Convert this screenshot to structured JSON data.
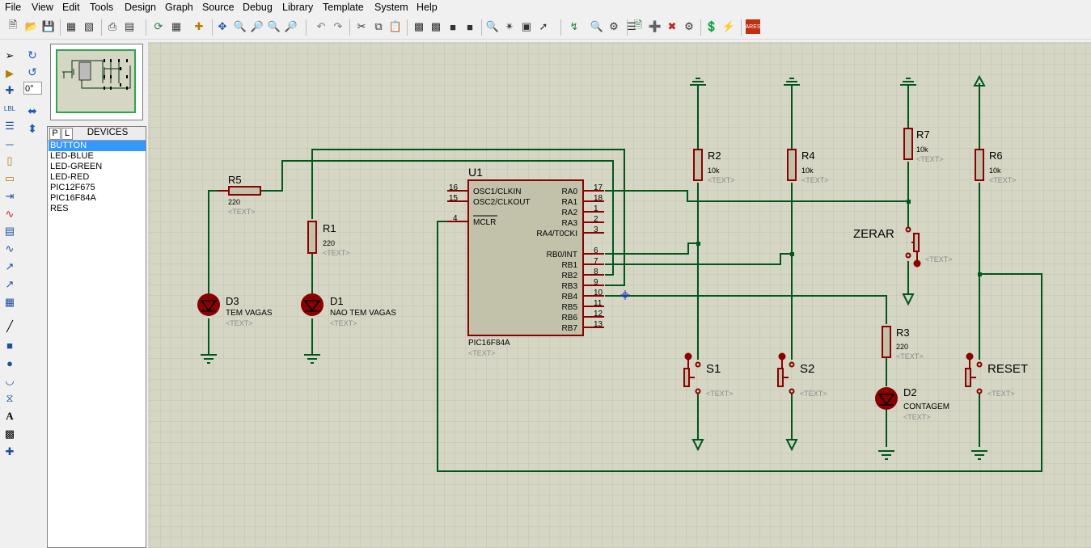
{
  "menu": [
    "File",
    "View",
    "Edit",
    "Tools",
    "Design",
    "Graph",
    "Source",
    "Debug",
    "Library",
    "Template",
    "System",
    "Help"
  ],
  "rotation": "0°",
  "device_panel": {
    "p_label": "P",
    "l_label": "L",
    "title": "DEVICES",
    "items": [
      "BUTTON",
      "LED-BLUE",
      "LED-GREEN",
      "LED-RED",
      "PIC12F675",
      "PIC16F84A",
      "RES"
    ],
    "selected": "BUTTON"
  },
  "schematic": {
    "chip": {
      "ref": "U1",
      "part": "PIC16F84A",
      "text": "<TEXT>",
      "left_pins": [
        {
          "num": "16",
          "name": "OSC1/CLKIN"
        },
        {
          "num": "15",
          "name": "OSC2/CLKOUT"
        },
        {
          "num": "4",
          "name": "MCLR"
        }
      ],
      "right_pins": [
        {
          "num": "17",
          "name": "RA0"
        },
        {
          "num": "18",
          "name": "RA1"
        },
        {
          "num": "1",
          "name": "RA2"
        },
        {
          "num": "2",
          "name": "RA3"
        },
        {
          "num": "3",
          "name": "RA4/T0CKI"
        },
        {
          "num": "6",
          "name": "RB0/INT"
        },
        {
          "num": "7",
          "name": "RB1"
        },
        {
          "num": "8",
          "name": "RB2"
        },
        {
          "num": "9",
          "name": "RB3"
        },
        {
          "num": "10",
          "name": "RB4"
        },
        {
          "num": "11",
          "name": "RB5"
        },
        {
          "num": "12",
          "name": "RB6"
        },
        {
          "num": "13",
          "name": "RB7"
        }
      ]
    },
    "resistors": [
      {
        "ref": "R5",
        "value": "220",
        "text": "<TEXT>"
      },
      {
        "ref": "R1",
        "value": "220",
        "text": "<TEXT>"
      },
      {
        "ref": "R2",
        "value": "10k",
        "text": "<TEXT>"
      },
      {
        "ref": "R4",
        "value": "10k",
        "text": "<TEXT>"
      },
      {
        "ref": "R7",
        "value": "10k",
        "text": "<TEXT>"
      },
      {
        "ref": "R6",
        "value": "10k",
        "text": "<TEXT>"
      },
      {
        "ref": "R3",
        "value": "220",
        "text": "<TEXT>"
      }
    ],
    "leds": [
      {
        "ref": "D3",
        "label": "TEM VAGAS",
        "text": "<TEXT>"
      },
      {
        "ref": "D1",
        "label": "NAO TEM VAGAS",
        "text": "<TEXT>"
      },
      {
        "ref": "D2",
        "label": "CONTAGEM",
        "text": "<TEXT>"
      }
    ],
    "buttons": [
      {
        "ref": "S1",
        "text": "<TEXT>"
      },
      {
        "ref": "S2",
        "text": "<TEXT>"
      },
      {
        "ref": "RESET",
        "text": "<TEXT>"
      },
      {
        "ref": "ZERAR",
        "text": "<TEXT>"
      }
    ],
    "colors": {
      "grid_bg": "#d6d6c4",
      "grid_line": "#c3c3b3",
      "wire": "#00561b",
      "component": "#8b0000",
      "chip_fill": "#c2c2ab",
      "text_gray": "#8a8a8a"
    }
  }
}
